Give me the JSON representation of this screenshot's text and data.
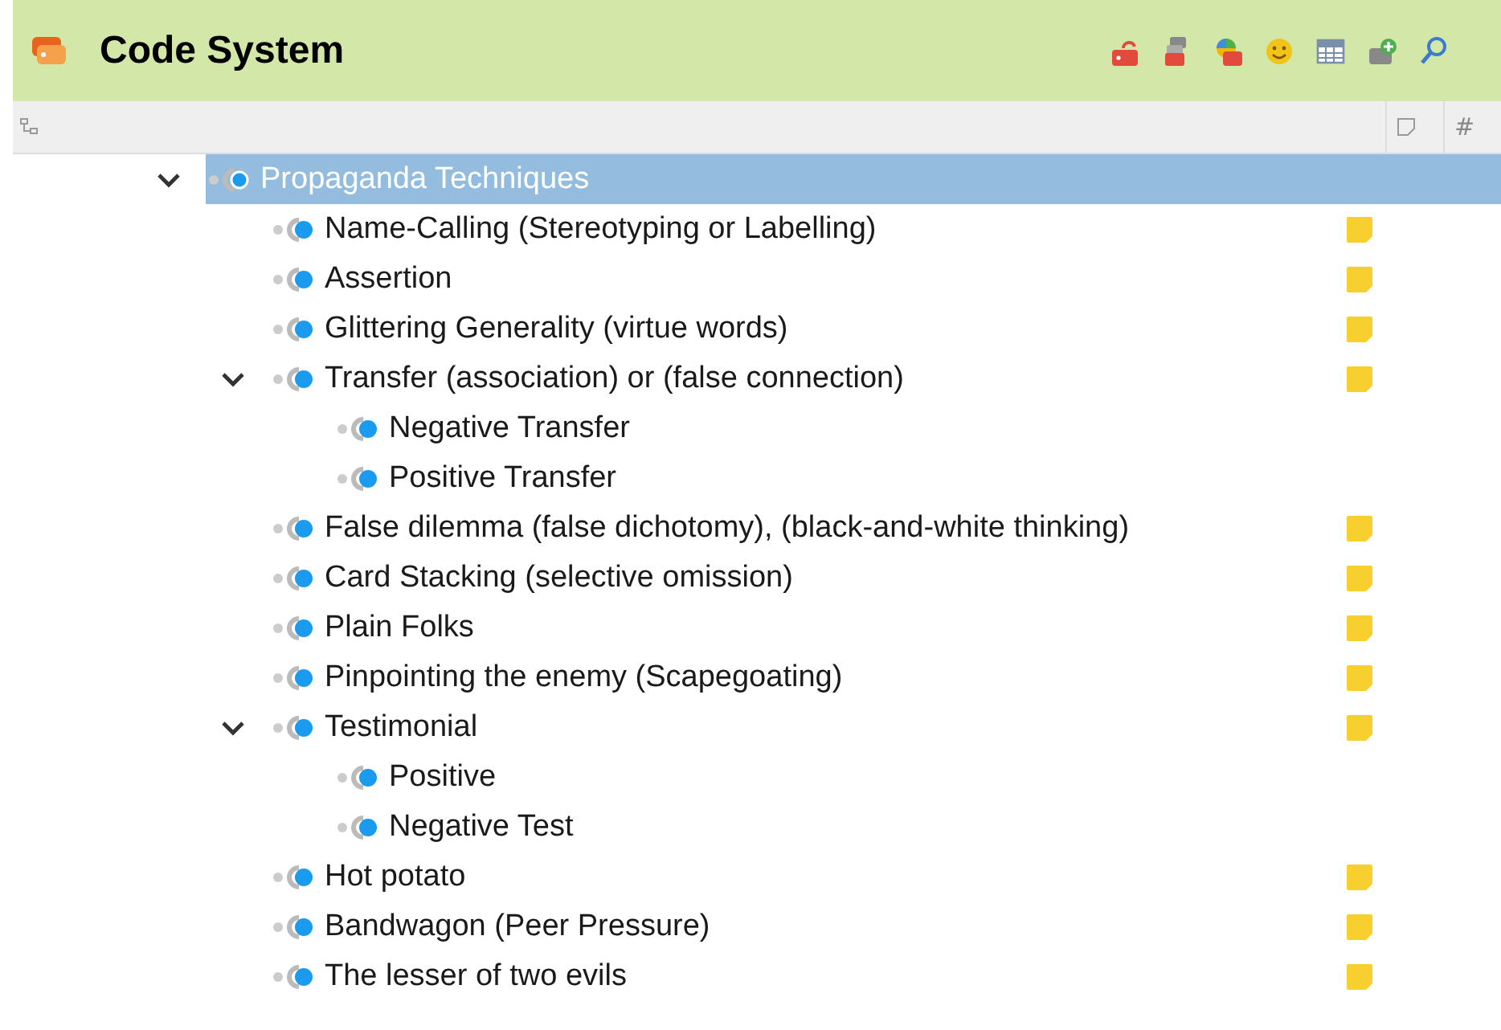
{
  "header": {
    "title": "Code System"
  },
  "columns": {
    "count_heading": "#"
  },
  "tree": [
    {
      "label": "Propaganda Techniques",
      "selected": true,
      "expanded": true,
      "memo": false,
      "children": [
        {
          "label": "Name-Calling (Stereotyping or Labelling)",
          "selected": false,
          "memo": true
        },
        {
          "label": "Assertion",
          "selected": false,
          "memo": true
        },
        {
          "label": "Glittering Generality (virtue words)",
          "selected": false,
          "memo": true
        },
        {
          "label": "Transfer (association) or (false connection)",
          "selected": false,
          "expanded": true,
          "memo": true,
          "children": [
            {
              "label": "Negative Transfer",
              "selected": false,
              "memo": false
            },
            {
              "label": "Positive Transfer",
              "selected": false,
              "memo": false
            }
          ]
        },
        {
          "label": "False dilemma (false dichotomy), (black-and-white thinking)",
          "selected": false,
          "memo": true
        },
        {
          "label": "Card Stacking (selective omission)",
          "selected": false,
          "memo": true
        },
        {
          "label": "Plain Folks",
          "selected": false,
          "memo": true
        },
        {
          "label": "Pinpointing the enemy (Scapegoating)",
          "selected": false,
          "memo": true
        },
        {
          "label": "Testimonial",
          "selected": false,
          "expanded": true,
          "memo": true,
          "children": [
            {
              "label": "Positive",
              "selected": false,
              "memo": false
            },
            {
              "label": "Negative Test",
              "selected": false,
              "memo": false
            }
          ]
        },
        {
          "label": "Hot potato",
          "selected": false,
          "memo": true
        },
        {
          "label": "Bandwagon (Peer Pressure)",
          "selected": false,
          "memo": true
        },
        {
          "label": "The lesser of two evils",
          "selected": false,
          "memo": true
        }
      ]
    }
  ]
}
